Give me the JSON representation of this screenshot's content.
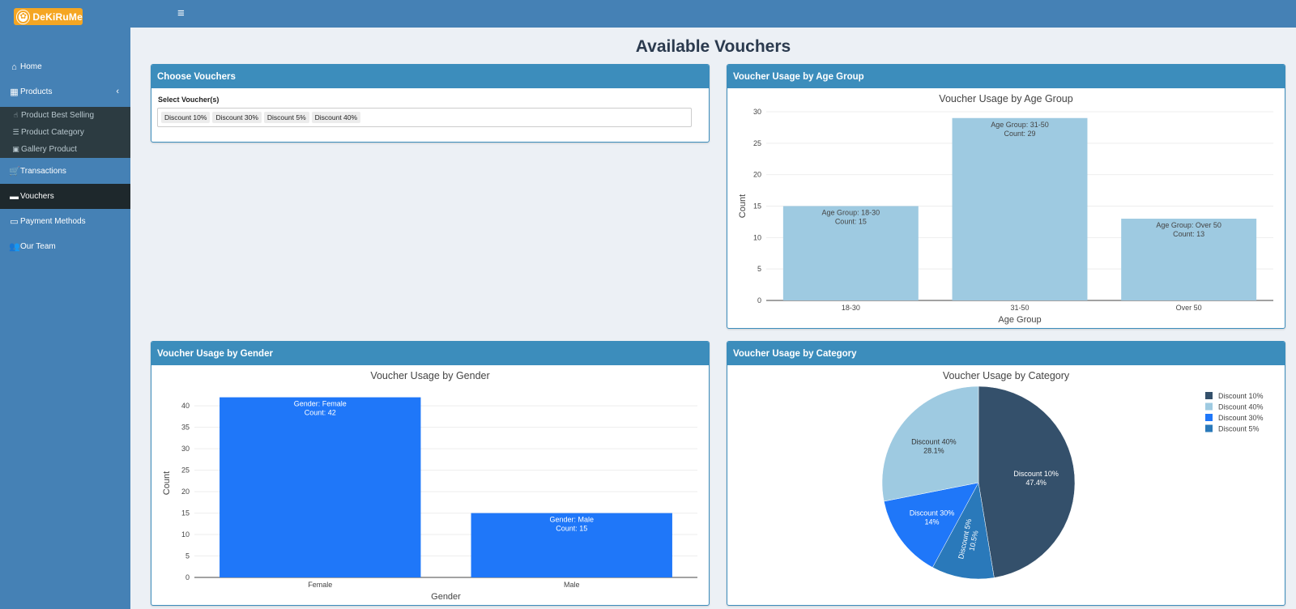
{
  "brand": {
    "logo_text": "DeKiRuMe",
    "logo_icon": "sun-flower-icon"
  },
  "topbar": {
    "menu_icon": "hamburger-icon"
  },
  "sidebar": {
    "items": [
      {
        "label": "Home",
        "icon": "home-icon"
      },
      {
        "label": "Products",
        "icon": "cubes-icon"
      },
      {
        "label": "Transactions",
        "icon": "cart-icon"
      },
      {
        "label": "Vouchers",
        "icon": "ticket-icon"
      },
      {
        "label": "Payment Methods",
        "icon": "credit-card-icon"
      },
      {
        "label": "Our Team",
        "icon": "users-icon"
      }
    ],
    "sub_items": [
      {
        "label": "Product Best Selling",
        "icon": "thumbs-up-icon"
      },
      {
        "label": "Product Category",
        "icon": "list-icon"
      },
      {
        "label": "Gallery Product",
        "icon": "image-icon"
      }
    ],
    "active": "Vouchers",
    "colors": {
      "bg": "#4581b5",
      "active": "#1e282c",
      "submenu": "#2c3b41"
    }
  },
  "main": {
    "title": "Available Vouchers"
  },
  "choose_panel": {
    "title": "Choose Vouchers",
    "select_label": "Select Voucher(s)",
    "selected": [
      "Discount 10%",
      "Discount 30%",
      "Discount 5%",
      "Discount 40%"
    ]
  },
  "panels": {
    "age": "Voucher Usage by Age Group",
    "gender": "Voucher Usage by Gender",
    "category": "Voucher Usage by Category"
  },
  "chart_data": [
    {
      "type": "bar",
      "title": "Voucher Usage by Age Group",
      "xlabel": "Age Group",
      "ylabel": "Count",
      "categories": [
        "18-30",
        "31-50",
        "Over 50"
      ],
      "values": [
        15,
        29,
        13
      ],
      "ylim": [
        0,
        30
      ],
      "yticks": [
        0,
        5,
        10,
        15,
        20,
        25,
        30
      ],
      "hover_label_key": "Age Group",
      "count_label_key": "Count",
      "color": "#9ecae1",
      "grid": true
    },
    {
      "type": "bar",
      "title": "Voucher Usage by Gender",
      "xlabel": "Gender",
      "ylabel": "Count",
      "categories": [
        "Female",
        "Male"
      ],
      "values": [
        42,
        15
      ],
      "ylim": [
        0,
        44
      ],
      "yticks": [
        0,
        5,
        10,
        15,
        20,
        25,
        30,
        35,
        40
      ],
      "hover_label_key": "Gender",
      "count_label_key": "Count",
      "color": "#1f77f9",
      "grid": true
    },
    {
      "type": "pie",
      "title": "Voucher Usage by Category",
      "slices": [
        {
          "label": "Discount 10%",
          "percent": 47.4,
          "percent_text": "47.4%",
          "color": "#34506b"
        },
        {
          "label": "Discount 5%",
          "percent": 10.5,
          "percent_text": "10.5%",
          "color": "#2a79ba"
        },
        {
          "label": "Discount 30%",
          "percent": 14.0,
          "percent_text": "14%",
          "color": "#1f77f9"
        },
        {
          "label": "Discount 40%",
          "percent": 28.1,
          "percent_text": "28.1%",
          "color": "#9ecae1"
        }
      ],
      "legend": [
        "Discount 10%",
        "Discount 40%",
        "Discount 30%",
        "Discount 5%"
      ],
      "legend_position": "top-right"
    }
  ]
}
